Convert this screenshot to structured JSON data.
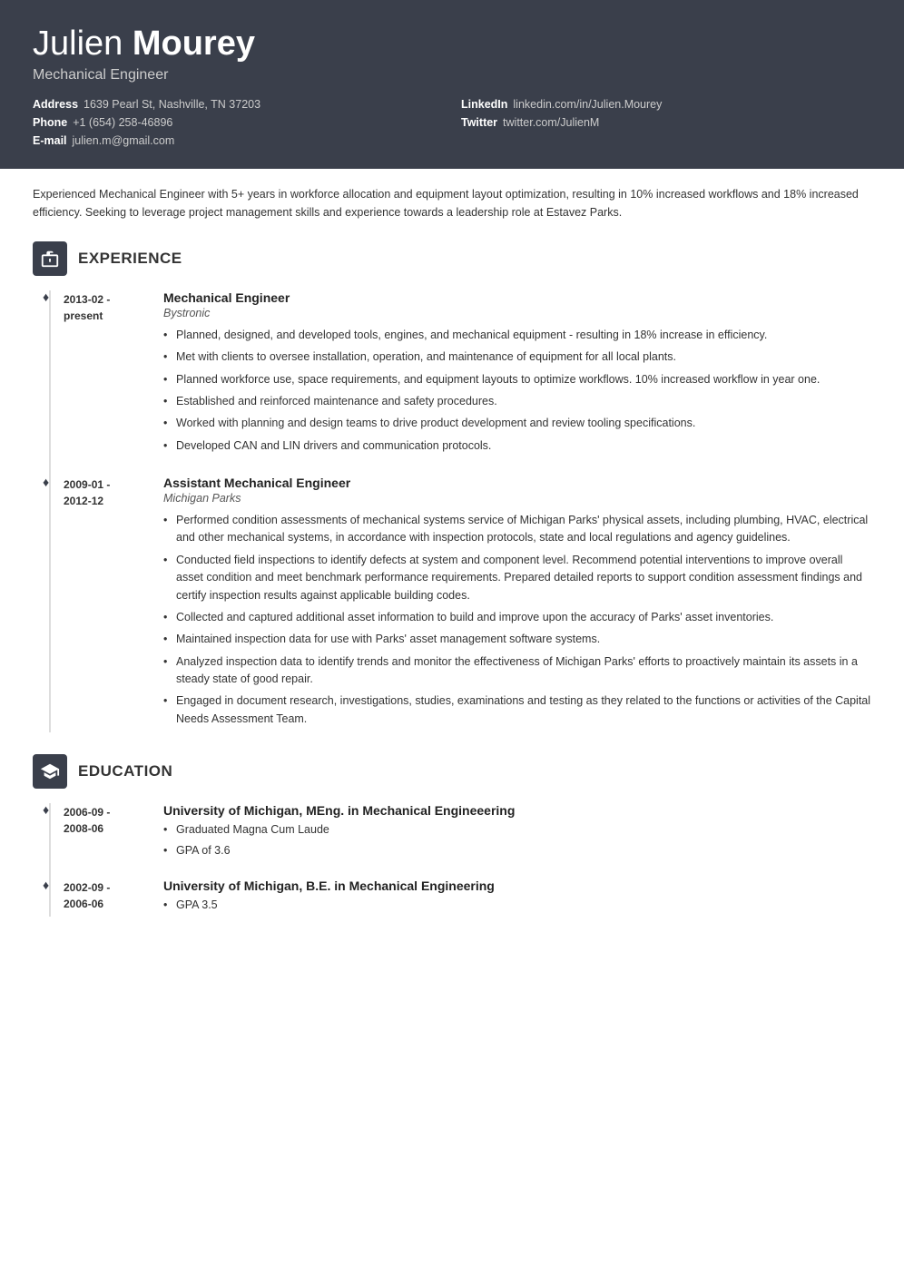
{
  "header": {
    "first_name": "Julien ",
    "last_name": "Mourey",
    "title": "Mechanical Engineer",
    "contact": [
      {
        "label": "Address",
        "value": "1639 Pearl St, Nashville, TN 37203"
      },
      {
        "label": "LinkedIn",
        "value": "linkedin.com/in/Julien.Mourey"
      },
      {
        "label": "Phone",
        "value": "+1 (654) 258-46896"
      },
      {
        "label": "Twitter",
        "value": "twitter.com/JulienM"
      },
      {
        "label": "E-mail",
        "value": "julien.m@gmail.com"
      }
    ]
  },
  "summary": "Experienced Mechanical Engineer with 5+ years in workforce allocation and equipment layout optimization, resulting in 10% increased workflows and 18% increased efficiency. Seeking to leverage project management skills and experience towards a leadership role at Estavez Parks.",
  "sections": {
    "experience": {
      "title": "EXPERIENCE",
      "items": [
        {
          "date_start": "2013-02 -",
          "date_end": "present",
          "job_title": "Mechanical Engineer",
          "company": "Bystronic",
          "bullets": [
            "Planned, designed, and developed tools, engines, and mechanical equipment - resulting in 18% increase in efficiency.",
            "Met with clients to oversee installation, operation, and maintenance of equipment for all local plants.",
            "Planned workforce use, space requirements, and equipment layouts to optimize workflows. 10% increased workflow in year one.",
            "Established and reinforced maintenance and safety procedures.",
            "Worked with planning and design teams to drive product development and review tooling specifications.",
            "Developed CAN and LIN drivers and communication protocols."
          ]
        },
        {
          "date_start": "2009-01 -",
          "date_end": "2012-12",
          "job_title": "Assistant Mechanical Engineer",
          "company": "Michigan Parks",
          "bullets": [
            "Performed condition assessments of mechanical systems service of Michigan Parks' physical assets, including plumbing, HVAC, electrical and other mechanical systems, in accordance with inspection protocols, state and local regulations and agency guidelines.",
            "Conducted field inspections to identify defects at system and component level. Recommend potential interventions to improve overall asset condition and meet benchmark performance requirements. Prepared detailed reports to support condition assessment findings and certify inspection results against applicable building codes.",
            "Collected and captured additional asset information to build and improve upon the accuracy of Parks' asset inventories.",
            "Maintained inspection data for use with Parks' asset management software systems.",
            "Analyzed inspection data to identify trends and monitor the effectiveness of Michigan Parks' efforts to proactively maintain its assets in a steady state of good repair.",
            "Engaged in document research, investigations, studies, examinations and testing as they related to the functions or activities of the Capital Needs Assessment Team."
          ]
        }
      ]
    },
    "education": {
      "title": "EDUCATION",
      "items": [
        {
          "date_start": "2006-09 -",
          "date_end": "2008-06",
          "degree": "University of Michigan, MEng. in Mechanical Engineeering",
          "bullets": [
            "Graduated Magna Cum Laude",
            "GPA of 3.6"
          ]
        },
        {
          "date_start": "2002-09 -",
          "date_end": "2006-06",
          "degree": "University of Michigan, B.E. in Mechanical Engineering",
          "bullets": [
            "GPA 3.5"
          ]
        }
      ]
    }
  }
}
